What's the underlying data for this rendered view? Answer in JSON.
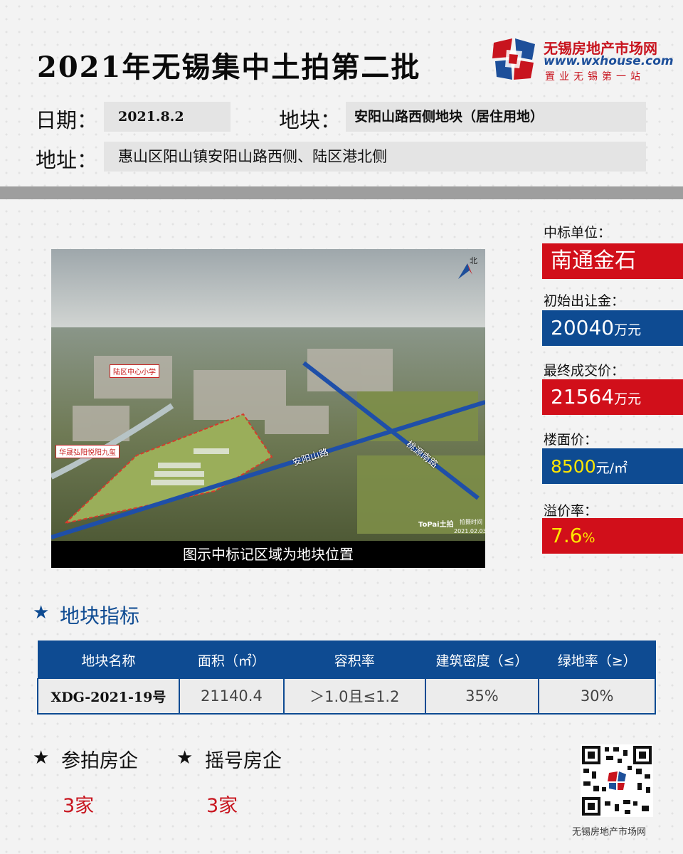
{
  "header": {
    "title": "2021年无锡集中土拍第二批",
    "logo_name": "无锡房地产市场网",
    "logo_url": "www.wxhouse.com",
    "logo_slogan": "置业无锡第一站"
  },
  "info": {
    "date_label": "日期：",
    "date_value": "2021.8.2",
    "plot_label": "地块：",
    "plot_value": "安阳山路西侧地块（居住用地）",
    "address_label": "地址：",
    "address_value": "惠山区阳山镇安阳山路西侧、陆区港北侧"
  },
  "photo": {
    "caption": "图示中标记区域为地块位置",
    "north": "北",
    "tag_school": "陆区中心小学",
    "tag_estate": "华晟弘阳悦阳九玺",
    "road_anyang": "安阳山路",
    "road_taoyuan": "桃源南路",
    "watermark": "ToPai土拍",
    "shot_label": "拍摄时间",
    "shot_date": "2021.02.03"
  },
  "results": {
    "winner_label": "中标单位：",
    "winner_value": "南通金石",
    "start_label": "初始出让金：",
    "start_value": "20040",
    "start_unit": "万元",
    "final_label": "最终成交价：",
    "final_value": "21564",
    "final_unit": "万元",
    "floor_label": "楼面价：",
    "floor_value": "8500",
    "floor_unit": "元/㎡",
    "premium_label": "溢价率：",
    "premium_value": "7.6",
    "premium_unit": "%"
  },
  "index": {
    "heading": "地块指标",
    "headers": [
      "地块名称",
      "面积（㎡）",
      "容积率",
      "建筑密度（≤）",
      "绿地率（≥）"
    ],
    "row": [
      "XDG-2021-19号",
      "21140.4",
      "＞1.0且≤1.2",
      "35%",
      "30%"
    ]
  },
  "bidders": {
    "participants_label": "参拍房企",
    "participants_value": "3家",
    "lottery_label": "摇号房企",
    "lottery_value": "3家"
  },
  "footer": {
    "qr_caption": "无锡房地产市场网"
  },
  "colors": {
    "red": "#d10f1a",
    "blue": "#0e4b92",
    "yellow": "#ffe600"
  }
}
